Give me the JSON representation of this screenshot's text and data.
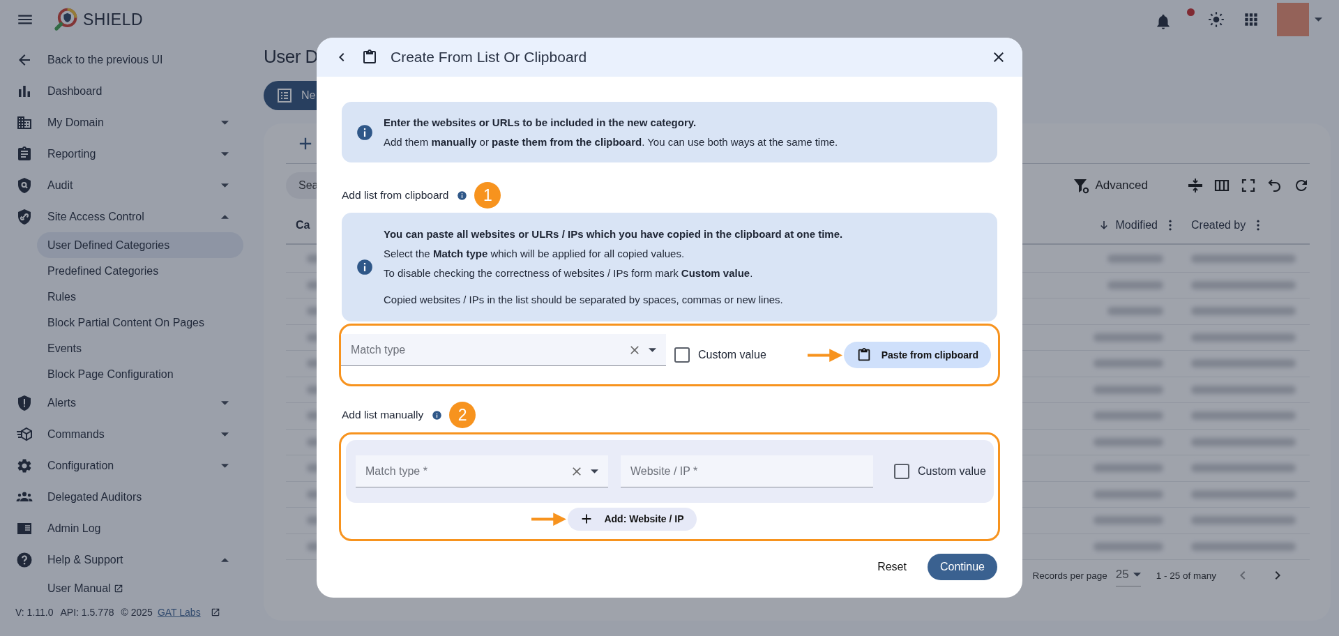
{
  "topbar": {
    "brand": "SHIELD"
  },
  "sidebar": {
    "items": [
      {
        "label": "Back to the previous UI"
      },
      {
        "label": "Dashboard"
      },
      {
        "label": "My Domain",
        "expanded": false
      },
      {
        "label": "Reporting",
        "expanded": false
      },
      {
        "label": "Audit",
        "expanded": false
      },
      {
        "label": "Site Access Control",
        "expanded": true,
        "children": [
          {
            "label": "User Defined Categories",
            "selected": true
          },
          {
            "label": "Predefined Categories",
            "selected": false
          },
          {
            "label": "Rules",
            "selected": false
          },
          {
            "label": "Block Partial Content On Pages",
            "selected": false
          },
          {
            "label": "Events",
            "selected": false
          },
          {
            "label": "Block Page Configuration",
            "selected": false
          }
        ]
      },
      {
        "label": "Alerts",
        "expanded": false
      },
      {
        "label": "Commands",
        "expanded": false
      },
      {
        "label": "Configuration",
        "expanded": false
      },
      {
        "label": "Delegated Auditors"
      },
      {
        "label": "Admin Log"
      },
      {
        "label": "Help & Support",
        "expanded": true,
        "children": [
          {
            "label": "User Manual",
            "selected": false
          }
        ]
      }
    ],
    "footer": {
      "version": "V: 1.11.0",
      "api": "API: 1.5.778",
      "copyright": "© 2025",
      "link": "GAT Labs"
    }
  },
  "page": {
    "title": "User D",
    "new_button": "Ne",
    "search_placeholder": "Sea",
    "advanced": "Advanced",
    "columns": [
      {
        "label": "Ca",
        "sorted": false
      },
      {
        "label": "Modified",
        "sorted": true
      },
      {
        "label": "Created by",
        "sorted": false
      }
    ],
    "pagination": {
      "records_label": "Records per page",
      "page_size": "25",
      "range": "1 - 25 of many"
    }
  },
  "dialog": {
    "title": "Create From List Or Clipboard",
    "intro": {
      "lines": [
        "Enter the websites or URLs to be included in the new category.",
        "Add them **manually** or **paste them from the clipboard**. You can use both ways at the same time."
      ]
    },
    "clipboard_section": {
      "label": "Add list from clipboard",
      "step": "1",
      "info": {
        "title": "You can paste all websites or ULRs / IPs which you have copied in the clipboard at one time.",
        "lines": [
          "Select the **Match type** which will be applied for all copied values.",
          "To disable checking the correctness of websites / IPs form mark **Custom value**."
        ],
        "note": "Copied websites / IPs in the list should be separated by spaces, commas or new lines."
      },
      "match_type": {
        "placeholder": "Match type"
      },
      "custom_value": {
        "label": "Custom value",
        "checked": false
      },
      "paste_button": "Paste from clipboard"
    },
    "manual_section": {
      "label": "Add list manually",
      "step": "2",
      "match_type": {
        "placeholder": "Match type *"
      },
      "website": {
        "placeholder": "Website / IP *"
      },
      "custom_value": {
        "label": "Custom value",
        "checked": false
      },
      "add_button": "Add: Website / IP"
    },
    "actions": {
      "reset": "Reset",
      "continue": "Continue"
    }
  }
}
